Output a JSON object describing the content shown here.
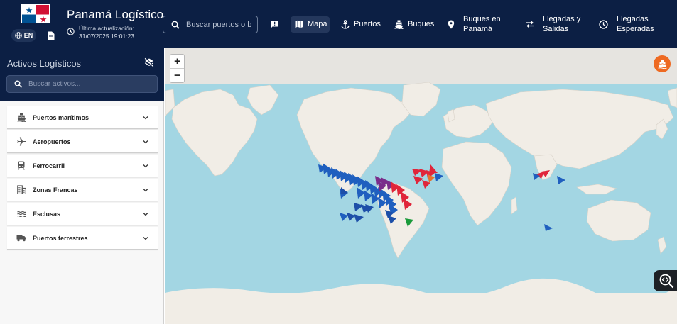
{
  "header": {
    "title": "Panamá Logístico",
    "language": "EN",
    "last_update": "Última actualización: 31/07/2025 19:01:23",
    "search_placeholder": "Buscar puertos o buques..."
  },
  "nav": [
    {
      "label": "",
      "icon": "feedback-icon"
    },
    {
      "label": "Mapa",
      "icon": "map-icon",
      "active": true
    },
    {
      "label": "Puertos",
      "icon": "anchor-icon"
    },
    {
      "label": "Buques",
      "icon": "ship-icon"
    },
    {
      "label": "Buques en Panamá",
      "icon": "location-pin-icon"
    },
    {
      "label": "Llegadas y Salidas",
      "icon": "swap-icon"
    },
    {
      "label": "Llegadas Esperadas",
      "icon": "clock-icon"
    }
  ],
  "sidebar": {
    "title": "Activos Logísticos",
    "search_placeholder": "Buscar activos...",
    "items": [
      {
        "label": "Puertos marítimos",
        "icon": "boat-icon"
      },
      {
        "label": "Aeropuertos",
        "icon": "airplane-icon"
      },
      {
        "label": "Ferrocarril",
        "icon": "train-icon"
      },
      {
        "label": "Zonas Francas",
        "icon": "building-icon"
      },
      {
        "label": "Esclusas",
        "icon": "waves-icon"
      },
      {
        "label": "Puertos terrestres",
        "icon": "truck-icon"
      }
    ]
  },
  "map": {
    "zoom_in": "+",
    "zoom_out": "−"
  },
  "colors": {
    "header_bg": "#0c1f44",
    "ocean": "#a3d6e3",
    "land": "#f1ede6",
    "accent_orange": "#ee6a22",
    "vessel_blue": "#1f5fbf",
    "vessel_red": "#e0253a",
    "vessel_green": "#1a9a3a"
  }
}
